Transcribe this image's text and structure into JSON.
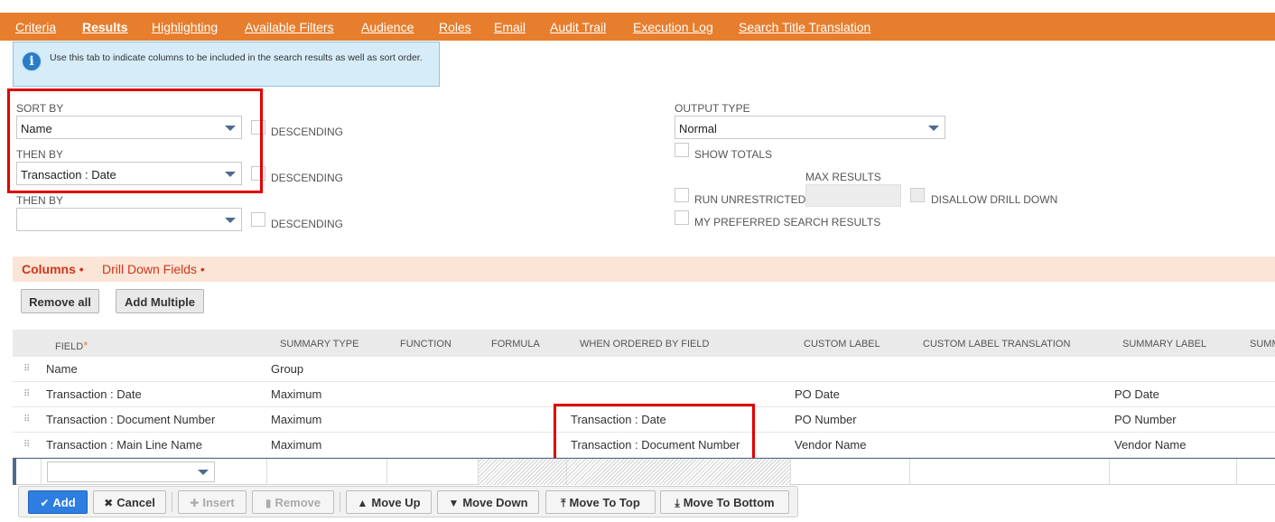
{
  "tabs": [
    {
      "label": "Criteria",
      "underline": "C"
    },
    {
      "label": "Results",
      "active": true
    },
    {
      "label": "Highlighting"
    },
    {
      "label": "Available Filters"
    },
    {
      "label": "Audience"
    },
    {
      "label": "Roles"
    },
    {
      "label": "Email"
    },
    {
      "label": "Audit Trail"
    },
    {
      "label": "Execution Log"
    },
    {
      "label": "Search Title Translation"
    }
  ],
  "info": {
    "text": "Use this tab to indicate columns to be included in the search results as well as sort order."
  },
  "sort": {
    "sort_by_label": "SORT BY",
    "sort_by_value": "Name",
    "then_by_label_1": "THEN BY",
    "then_by_value_1": "Transaction : Date",
    "then_by_label_2": "THEN BY",
    "then_by_value_2": "",
    "descending_label": "DESCENDING"
  },
  "output": {
    "output_type_label": "OUTPUT TYPE",
    "output_type_value": "Normal",
    "show_totals_label": "SHOW TOTALS",
    "max_results_label": "MAX RESULTS",
    "run_unrestricted_label": "RUN UNRESTRICTED",
    "disallow_drill_down_label": "DISALLOW DRILL DOWN",
    "my_preferred_label": "MY PREFERRED SEARCH RESULTS"
  },
  "subtabs": {
    "columns": "Columns",
    "drill_down": "Drill Down Fields",
    "dot": "•"
  },
  "buttons": {
    "remove_all": "Remove all",
    "add_multiple": "Add Multiple"
  },
  "grid": {
    "headers": {
      "field": "FIELD",
      "required_mark": "*",
      "summary_type": "SUMMARY TYPE",
      "function": "FUNCTION",
      "formula": "FORMULA",
      "when_ordered": "WHEN ORDERED BY FIELD",
      "custom_label": "CUSTOM LABEL",
      "custom_label_translation": "CUSTOM LABEL TRANSLATION",
      "summary_label": "SUMMARY LABEL",
      "summ_cut": "SUMM"
    },
    "rows": [
      {
        "field": "Name",
        "summary_type": "Group",
        "when_ordered": "",
        "custom_label": "",
        "summary_label": ""
      },
      {
        "field": "Transaction : Date",
        "summary_type": "Maximum",
        "when_ordered": "",
        "custom_label": "PO Date",
        "summary_label": "PO Date"
      },
      {
        "field": "Transaction : Document Number",
        "summary_type": "Maximum",
        "when_ordered": "Transaction : Date",
        "custom_label": "PO Number",
        "summary_label": "PO Number"
      },
      {
        "field": "Transaction : Main Line Name",
        "summary_type": "Maximum",
        "when_ordered": "Transaction : Document Number",
        "custom_label": "Vendor Name",
        "summary_label": "Vendor Name"
      }
    ]
  },
  "actions": {
    "add": "Add",
    "cancel": "Cancel",
    "insert": "Insert",
    "remove": "Remove",
    "move_up": "Move Up",
    "move_down": "Move Down",
    "move_to_top": "Move To Top",
    "move_to_bottom": "Move To Bottom"
  },
  "colors": {
    "tab_bar": "#e67e2e",
    "highlight_box": "#e00000",
    "primary_button": "#2d7ee0"
  }
}
